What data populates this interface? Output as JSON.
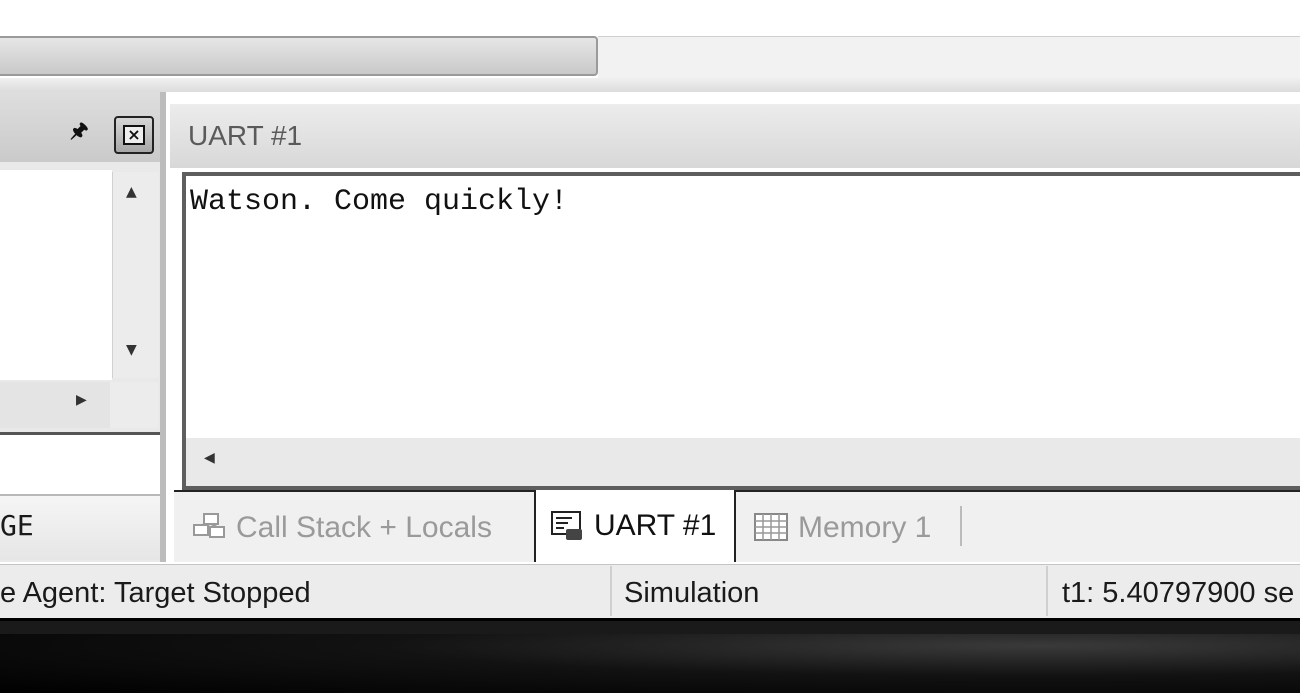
{
  "uart_panel": {
    "title": "UART #1",
    "output_text": "Watson. Come quickly!"
  },
  "left_panel": {
    "tab_label": "GE"
  },
  "tabs": [
    {
      "label": "Call Stack + Locals",
      "icon": "call-stack-icon",
      "active": false
    },
    {
      "label": "UART #1",
      "icon": "uart-icon",
      "active": true
    },
    {
      "label": "Memory 1",
      "icon": "memory-icon",
      "active": false
    }
  ],
  "status_bar": {
    "agent": "e Agent: Target Stopped",
    "mode": "Simulation",
    "time": "t1: 5.40797900 se"
  }
}
